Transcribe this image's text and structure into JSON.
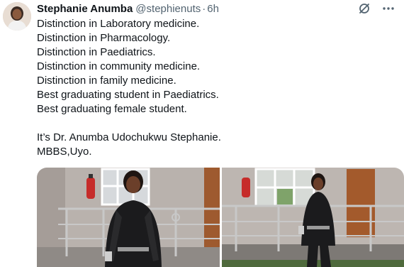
{
  "author": {
    "display_name": "Stephanie Anumba",
    "handle": "@stephienuts",
    "separator": "·",
    "time": "6h"
  },
  "icons": {
    "avatar": "profile-photo",
    "grok_icon": "slashed-circle-icon",
    "more_icon": "more-horizontal-icon"
  },
  "tweet": {
    "lines": [
      "Distinction in Laboratory medicine.",
      "Distinction in Pharmacology.",
      "Distinction in Paediatrics.",
      "Distinction in community medicine.",
      "Distinction in family medicine.",
      "Best graduating student in Paediatrics.",
      "Best graduating female student."
    ],
    "closing_lines": [
      "It’s Dr. Anumba Udochukwu Stephanie.",
      "MBBS,Uyo."
    ]
  },
  "media": {
    "count": 2
  },
  "colors": {
    "text": "#0f1419",
    "muted": "#536471",
    "background": "#ffffff"
  }
}
